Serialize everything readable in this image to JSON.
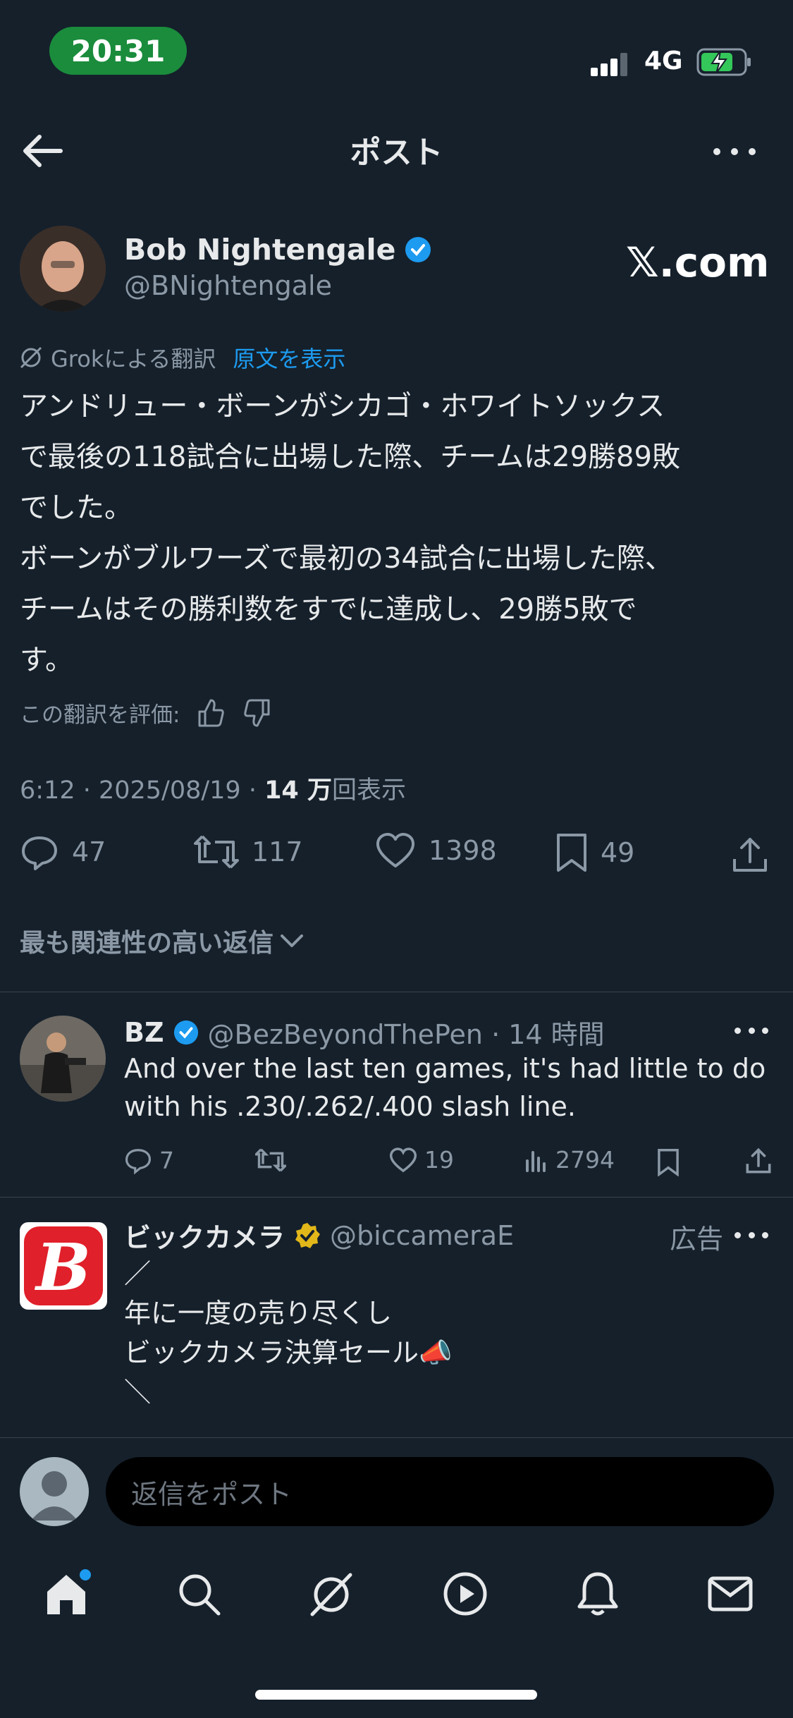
{
  "status_bar": {
    "time": "20:31",
    "network": "4G"
  },
  "header": {
    "title": "ポスト"
  },
  "post": {
    "author_name": "Bob Nightengale",
    "author_handle": "@BNightengale",
    "watermark": "𝕏.com",
    "translation_label": "Grokによる翻訳",
    "show_original": "原文を表示",
    "text": "アンドリュー・ボーンがシカゴ・ホワイトソックス\nで最後の118試合に出場した際、チームは29勝89敗\nでした。\nボーンがブルワーズで最初の34試合に出場した際、\nチームはその勝利数をすでに達成し、29勝5敗で\nす。",
    "rate_label": "この翻訳を評価:",
    "timestamp": "6:12 · 2025/08/19 · ",
    "views_count": "14 万",
    "views_label": "回表示",
    "replies": "47",
    "reposts": "117",
    "likes": "1398",
    "bookmarks": "49",
    "sort_label": "最も関連性の高い返信"
  },
  "reply": {
    "name": "BZ",
    "handle": "@BezBeyondThePen · 14 時間",
    "text": "And over the last ten games, it's had little to do\nwith his .230/.262/.400 slash line.",
    "replies": "7",
    "likes": "19",
    "views": "2794"
  },
  "ad": {
    "name": "ビックカメラ",
    "handle": "@biccameraE",
    "ad_label": "広告",
    "text": "／\n年に一度の売り尽くし\nビックカメラ決算セール📣\n＼"
  },
  "composer": {
    "placeholder": "返信をポスト"
  },
  "colors": {
    "background": "#15202b",
    "accent": "#1d9bf0",
    "muted": "#8b98a5",
    "gold_badge": "#e2b719",
    "bic_red": "#e0202a"
  },
  "icons": [
    "back-arrow-icon",
    "more-icon",
    "verified-icon",
    "grok-icon",
    "thumbs-up-icon",
    "thumbs-down-icon",
    "reply-icon",
    "repost-icon",
    "like-icon",
    "bookmark-icon",
    "share-icon",
    "views-icon",
    "chevron-down-icon",
    "home-icon",
    "search-icon",
    "grok-tab-icon",
    "video-icon",
    "bell-icon",
    "mail-icon"
  ]
}
